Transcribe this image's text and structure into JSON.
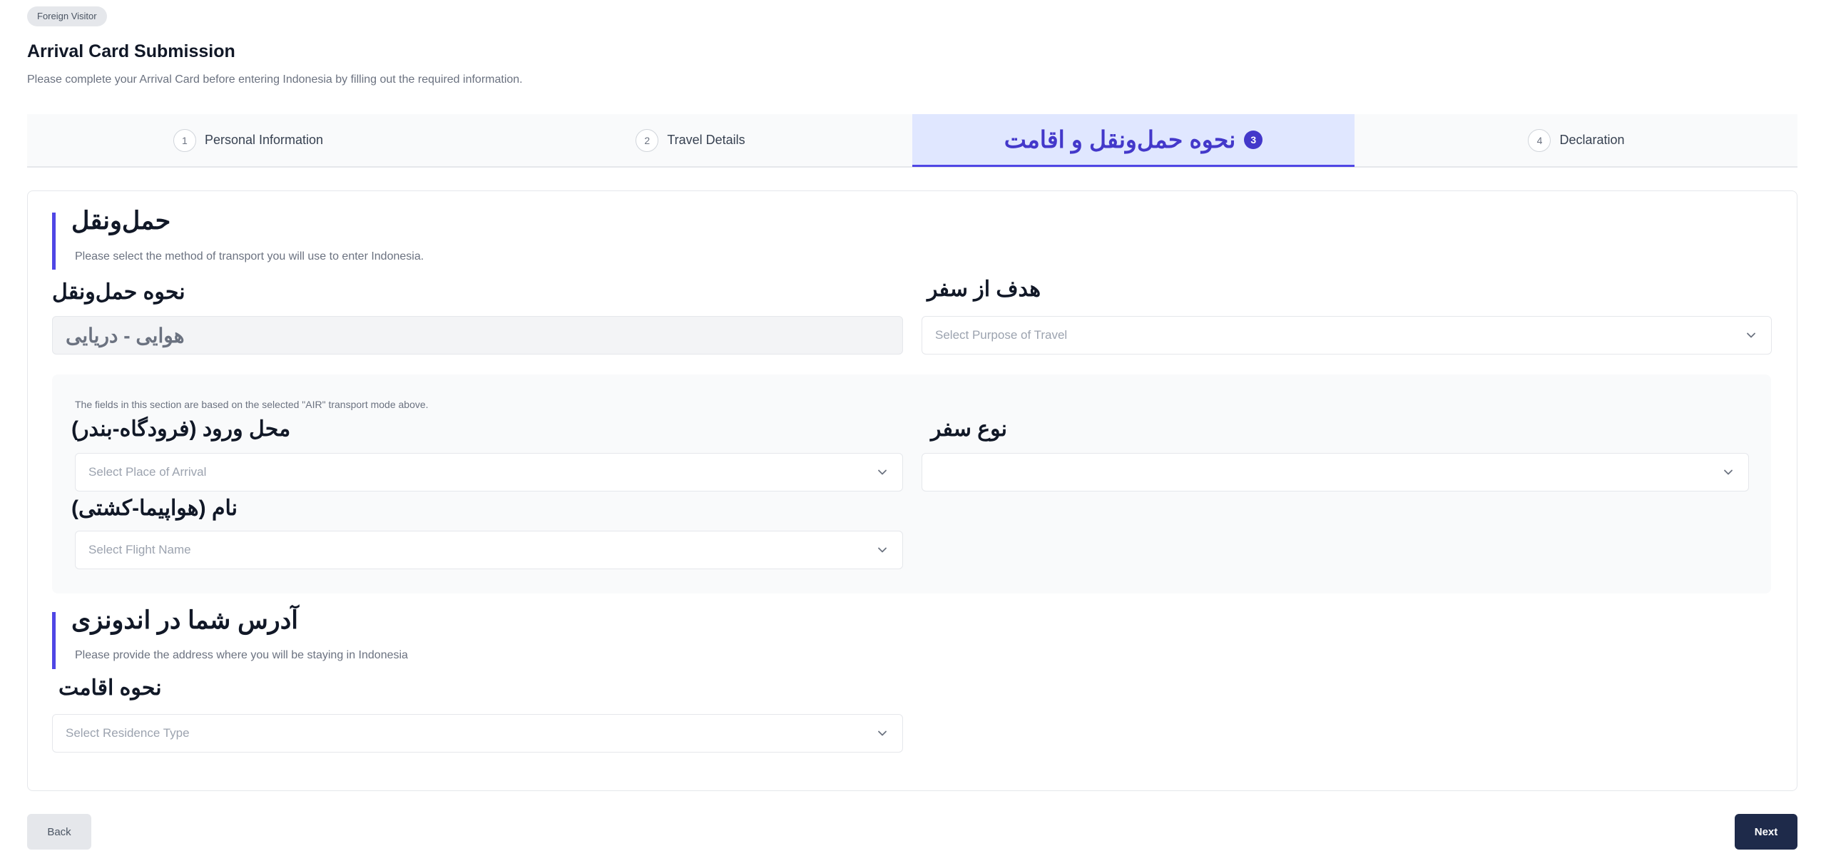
{
  "header": {
    "badge": "Foreign Visitor",
    "title": "Arrival Card Submission",
    "subtitle": "Please complete your Arrival Card before entering Indonesia by filling out the required information."
  },
  "steps": [
    {
      "num": "1",
      "label": "Personal Information"
    },
    {
      "num": "2",
      "label": "Travel Details"
    },
    {
      "num": "3",
      "label": "نحوه حمل‌ونقل و اقامت"
    },
    {
      "num": "4",
      "label": "Declaration"
    }
  ],
  "transport": {
    "title": "حمل‌ونقل",
    "hint": "Please select the method of transport you will use to enter Indonesia.",
    "mode_label": "نحوه حمل‌ونقل",
    "mode_value": "هوایی - دریایی",
    "purpose_label": "هدف از سفر",
    "purpose_placeholder": "Select Purpose of Travel",
    "section_note": "The fields in this section are based on the selected \"AIR\" transport mode above.",
    "arrival_place_label": "محل ورود (فرودگاه-بندر)",
    "arrival_place_placeholder": "Select Place of Arrival",
    "trip_type_label": "نوع سفر",
    "trip_type_value": "",
    "vessel_name_label": "نام (هواپیما-کشتی)",
    "vessel_name_placeholder": "Select Flight Name"
  },
  "address": {
    "title": "آدرس شما در اندونزی",
    "hint": "Please provide the address where you will be staying in Indonesia",
    "residence_label": "نحوه اقامت",
    "residence_placeholder": "Select Residence Type"
  },
  "footer": {
    "back_label": "Back",
    "next_label": "Next"
  },
  "colors": {
    "accent": "#4f46e5",
    "active_tab_bg": "#e0e7ff",
    "next_button": "#1e2a4a"
  }
}
